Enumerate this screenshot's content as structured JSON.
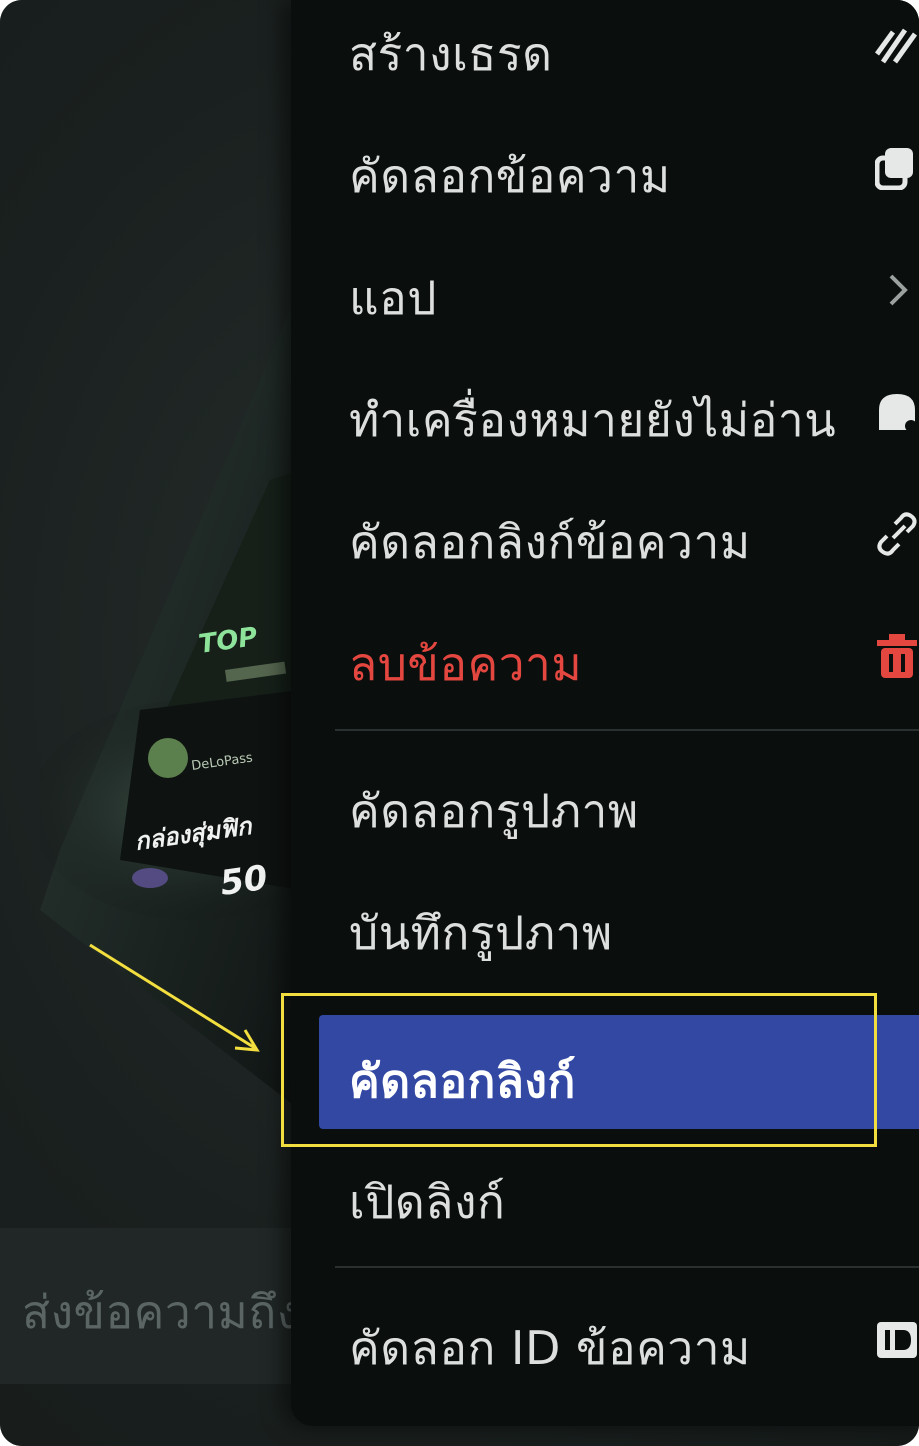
{
  "chat": {
    "input_placeholder": "ส่งข้อความถึง",
    "preview_text_top": "TOP",
    "preview_brand": "DeLoPass",
    "preview_caption": "กล่องสุ่มฟิก",
    "preview_number": "50"
  },
  "menu": {
    "items": [
      {
        "label": "สร้างเธรด",
        "icon": "thread-icon"
      },
      {
        "label": "คัดลอกข้อความ",
        "icon": "copy-icon"
      },
      {
        "label": "แอป",
        "icon": "chevron-right-icon"
      },
      {
        "label": "ทำเครื่องหมายยังไม่อ่าน",
        "icon": "unread-icon"
      },
      {
        "label": "คัดลอกลิงก์ข้อความ",
        "icon": "link-icon"
      },
      {
        "label": "ลบข้อความ",
        "icon": "trash-icon",
        "color": "#e3473f"
      },
      {
        "label": "คัดลอกรูปภาพ"
      },
      {
        "label": "บันทึกรูปภาพ"
      },
      {
        "label": "คัดลอกลิงก์",
        "selected": true
      },
      {
        "label": "เปิดลิงก์"
      },
      {
        "label": "คัดลอก ID ข้อความ",
        "icon": "id-icon"
      }
    ]
  },
  "colors": {
    "menu_bg": "#0a0e0d",
    "selected_bg": "#3348a3",
    "highlight": "#f2df3f",
    "danger": "#e3473f"
  }
}
